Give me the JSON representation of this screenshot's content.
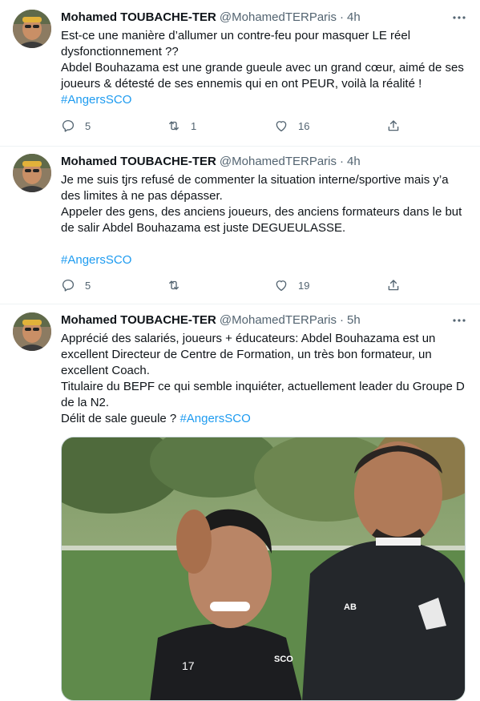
{
  "tweets": [
    {
      "author": "Mohamed TOUBACHE-TER",
      "handle": "@MohamedTERParis",
      "sep": "·",
      "time": "4h",
      "lines": [
        "Est-ce une manière d’allumer un contre-feu pour masquer LE réel",
        "dysfonctionnement ??",
        "Abdel Bouhazama est une grande gueule avec un grand cœur, aimé de ses",
        "joueurs & détesté de ses ennemis qui en ont PEUR, voilà la réalité !"
      ],
      "hashtag": "#AngersSCO",
      "replies": "5",
      "retweets": "1",
      "likes": "16"
    },
    {
      "author": "Mohamed TOUBACHE-TER",
      "handle": "@MohamedTERParis",
      "sep": "·",
      "time": "4h",
      "lines": [
        "Je me suis tjrs refusé de commenter la situation interne/sportive mais y’a",
        "des limites à ne pas dépasser.",
        "Appeler des gens, des anciens joueurs, des anciens formateurs dans le but",
        "de salir Abdel Bouhazama est juste DEGUEULASSE."
      ],
      "hashtag": "#AngersSCO",
      "replies": "5",
      "retweets": "",
      "likes": "19"
    },
    {
      "author": "Mohamed TOUBACHE-TER",
      "handle": "@MohamedTERParis",
      "sep": "·",
      "time": "5h",
      "lines": [
        "Apprécié des salariés, joueurs + éducateurs: Abdel Bouhazama est un",
        "excellent Directeur de Centre de Formation, un très bon formateur, un",
        "excellent Coach.",
        "Titulaire du BEPF ce qui semble inquiéter, actuellement leader du Groupe D",
        "de la N2."
      ],
      "last_line_prefix": "Délit de sale gueule ? ",
      "hashtag": "#AngersSCO",
      "photo": {
        "shirt_number": "17",
        "shirt_text": "SCO",
        "jacket_initials": "AB"
      }
    }
  ],
  "colors": {
    "text": "#0f1419",
    "secondary": "#536471",
    "link": "#1d9bf0",
    "divider": "#eff3f4"
  },
  "icons": [
    "reply-icon",
    "retweet-icon",
    "like-icon",
    "share-icon",
    "more-icon"
  ]
}
